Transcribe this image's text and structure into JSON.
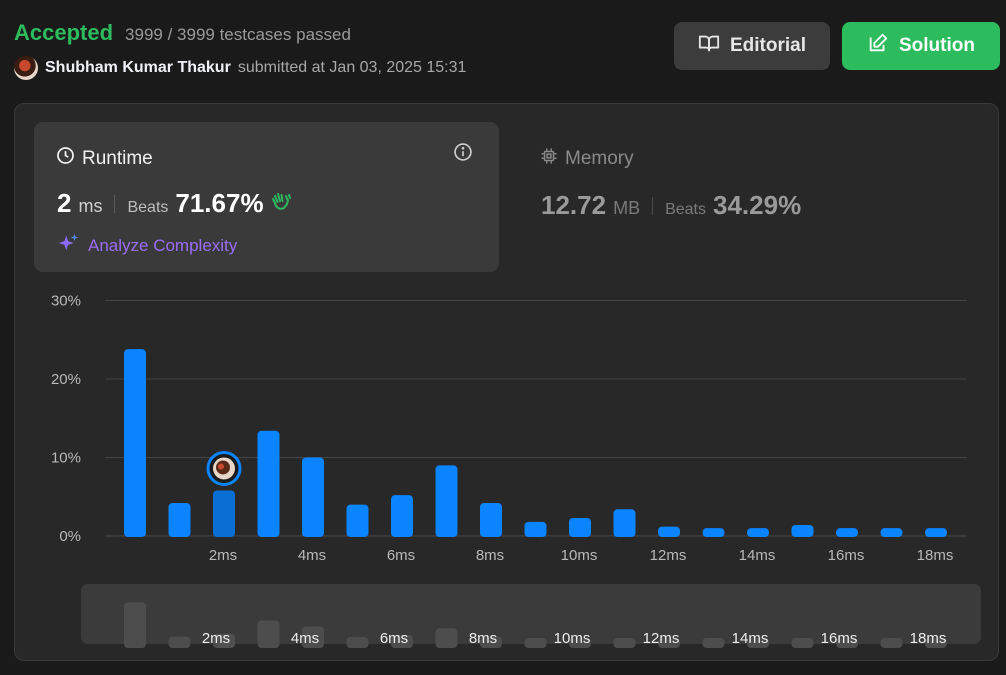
{
  "header": {
    "status": "Accepted",
    "testcases": "3999 / 3999 testcases passed",
    "submitter": "Shubham Kumar Thakur",
    "submitted_at": "submitted at Jan 03, 2025 15:31"
  },
  "buttons": {
    "editorial_label": "Editorial",
    "solution_label": "Solution"
  },
  "runtime": {
    "title": "Runtime",
    "value": "2",
    "unit": "ms",
    "beats_label": "Beats",
    "beats_value": "71.67%",
    "analyze_label": "Analyze Complexity"
  },
  "memory": {
    "title": "Memory",
    "value": "12.72",
    "unit": "MB",
    "beats_label": "Beats",
    "beats_value": "34.29%"
  },
  "colors": {
    "accent_green": "#2cbb5d",
    "bar_blue": "#0a84ff",
    "analyze_purple": "#9c6cf5"
  },
  "chart_data": {
    "type": "bar",
    "y_ticks": [
      "30%",
      "20%",
      "10%",
      "0%"
    ],
    "ylim": [
      0,
      30
    ],
    "x_tick_labels": [
      "2ms",
      "4ms",
      "6ms",
      "8ms",
      "10ms",
      "12ms",
      "14ms",
      "16ms",
      "18ms"
    ],
    "values": [
      23.8,
      4.2,
      5.8,
      13.4,
      10.0,
      4.0,
      5.2,
      9.0,
      4.2,
      1.8,
      2.3,
      3.4,
      1.2,
      1.0,
      1.0,
      1.4,
      1.0,
      1.0,
      1.0
    ],
    "user_bar_index": 2,
    "grid": true
  }
}
